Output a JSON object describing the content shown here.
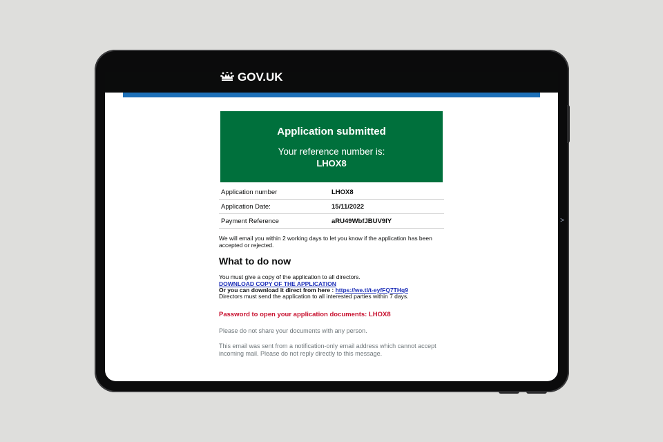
{
  "header": {
    "logo_text": "GOV.UK",
    "logo_icon": "crown-icon"
  },
  "panel": {
    "title": "Application submitted",
    "subtitle": "Your reference number is:",
    "reference": "LHOX8"
  },
  "summary": {
    "rows": [
      {
        "key": "Application number",
        "value": "LHOX8"
      },
      {
        "key": "Application Date:",
        "value": "15/11/2022"
      },
      {
        "key": "Payment Reference",
        "value": "aRU49WbfJBUV9lY"
      }
    ]
  },
  "notice": "We will email you within 2 working days to let you know if the application has been accepted or rejected.",
  "what_to_do": {
    "heading": "What to do now",
    "line1": "You must give a copy of the application to all directors.",
    "download_link": "DOWNLOAD COPY OF THE APPLICATION",
    "direct_label": "Or you can download it direct from here : ",
    "direct_url": "https://we.tl/t-eyfFQ7THq9",
    "line4": "Directors must send the application to all interested parties within 7 days."
  },
  "password_line": "Password to open your application documents: LHOX8",
  "footer": {
    "share_warning": "Please do not share your documents with any person.",
    "notification": "This email was sent from a notification-only email address which cannot accept incoming mail. Please do not reply directly to this message."
  },
  "device": {
    "side_arrow": ">"
  },
  "colors": {
    "gov_green": "#00703c",
    "gov_blue": "#1d70b8",
    "header_black": "#0b0c0c",
    "alert_red": "#c8102e"
  }
}
